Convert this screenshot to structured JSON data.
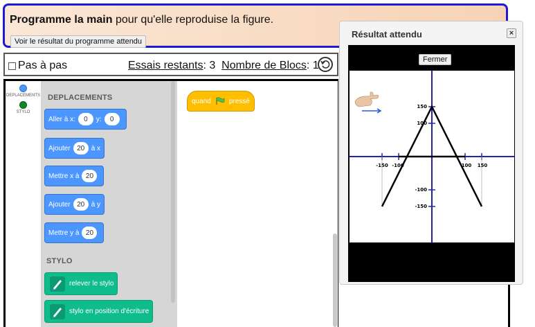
{
  "banner": {
    "instruction_bold": "Programme la main",
    "instruction_rest": " pour qu'elle reproduise la figure.",
    "see_result_button": "Voir le résultat du programme attendu"
  },
  "controls": {
    "step_label": "Pas à pas",
    "tries_label": "Essais restants",
    "tries_value": ": 3",
    "blocks_label": "Nombre de Blocs",
    "blocks_value": ": 1"
  },
  "categories": [
    {
      "label": "DEPLACEMENTS",
      "color": "#4c97ff"
    },
    {
      "label": "STYLO",
      "color": "#0fbd8c"
    }
  ],
  "palette": {
    "section_moves": "DEPLACEMENTS",
    "section_pen": "STYLO",
    "goto": {
      "prefix": "Aller à x:",
      "x": "0",
      "ymid": "y:",
      "y": "0"
    },
    "add_x": {
      "prefix": "Ajouter",
      "value": "20",
      "suffix": "à x"
    },
    "set_x": {
      "prefix": "Mettre x à",
      "value": "20"
    },
    "add_y": {
      "prefix": "Ajouter",
      "value": "20",
      "suffix": "à y"
    },
    "set_y": {
      "prefix": "Mettre y à",
      "value": "20"
    },
    "pen_up": "relever le stylo",
    "pen_down": "stylo en position d'écriture"
  },
  "script": {
    "hat_prefix": "quand",
    "hat_suffix": "pressé"
  },
  "dialog": {
    "title": "Résultat attendu",
    "close_glyph": "×",
    "fermer_button": "Fermer"
  },
  "plot": {
    "x_ticks": [
      "-150",
      "-100",
      "100",
      "150"
    ],
    "y_ticks": [
      "150",
      "100",
      "-100",
      "-150"
    ],
    "axis_color": "#2222aa",
    "line_color": "#000000"
  }
}
